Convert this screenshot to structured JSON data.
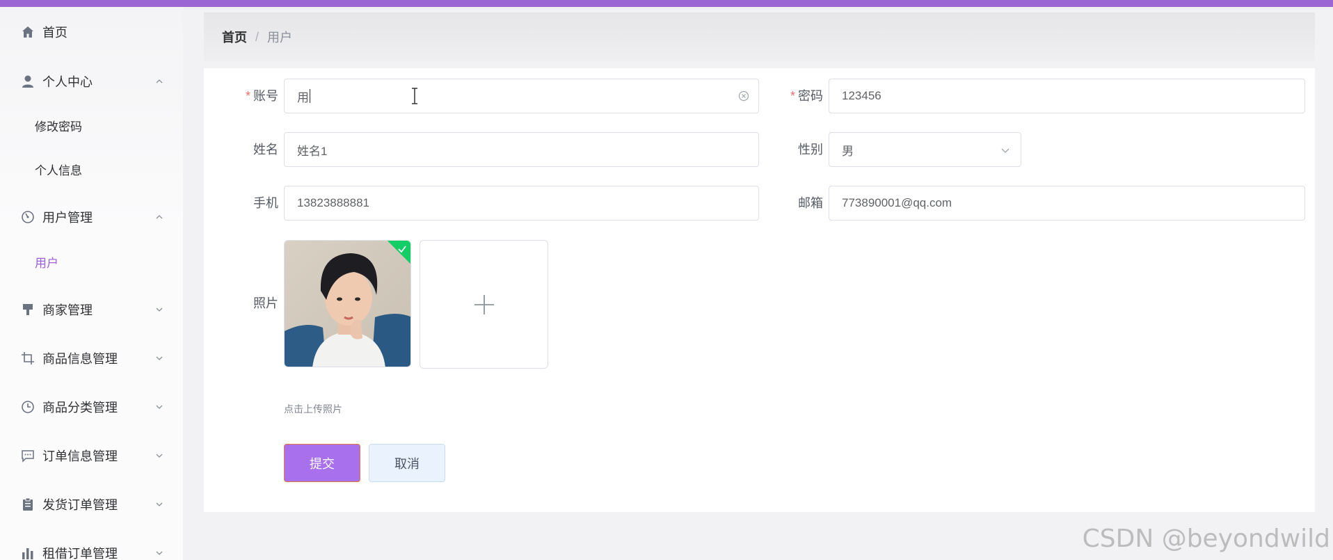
{
  "sidebar": {
    "items": [
      {
        "label": "首页",
        "icon": "home-icon"
      },
      {
        "label": "个人中心",
        "icon": "user-icon",
        "expanded": true
      },
      {
        "label": "修改密码",
        "sub": true
      },
      {
        "label": "个人信息",
        "sub": true
      },
      {
        "label": "用户管理",
        "icon": "dashboard-icon",
        "expanded": true
      },
      {
        "label": "用户",
        "sub": true,
        "active": true
      },
      {
        "label": "商家管理",
        "icon": "brush-icon"
      },
      {
        "label": "商品信息管理",
        "icon": "crop-icon"
      },
      {
        "label": "商品分类管理",
        "icon": "clock-icon"
      },
      {
        "label": "订单信息管理",
        "icon": "chat-icon"
      },
      {
        "label": "发货订单管理",
        "icon": "clipboard-icon"
      },
      {
        "label": "租借订单管理",
        "icon": "bar-chart-icon"
      }
    ]
  },
  "breadcrumb": {
    "home": "首页",
    "separator": "/",
    "current": "用户"
  },
  "form": {
    "account_label": "账号",
    "account_value": "用",
    "password_label": "密码",
    "password_value": "123456",
    "name_label": "姓名",
    "name_value": "姓名1",
    "gender_label": "性别",
    "gender_value": "男",
    "phone_label": "手机",
    "phone_value": "13823888881",
    "email_label": "邮箱",
    "email_value": "773890001@qq.com",
    "photo_label": "照片",
    "upload_tip": "点击上传照片",
    "required_mark": "*"
  },
  "buttons": {
    "submit": "提交",
    "cancel": "取消"
  },
  "watermark": "CSDN @beyondwild",
  "colors": {
    "accent": "#9b66d3",
    "active_menu": "#9b5fd6",
    "success": "#13ce66",
    "required": "#f56c6c"
  }
}
